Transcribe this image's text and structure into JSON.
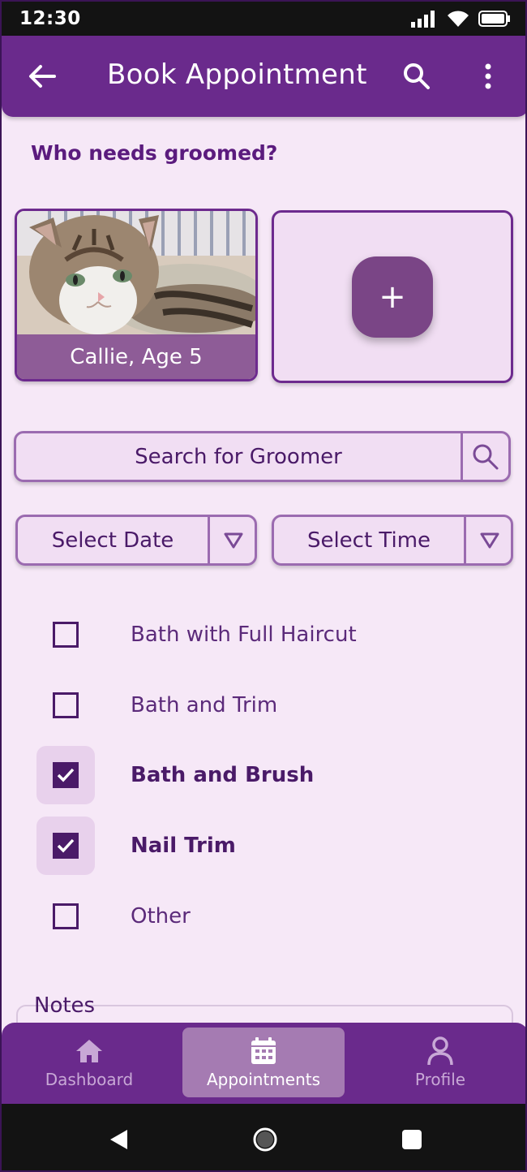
{
  "status_bar": {
    "time": "12:30"
  },
  "app_bar": {
    "title": "Book Appointment"
  },
  "section": {
    "title": "Who needs groomed?"
  },
  "pets": [
    {
      "caption": "Callie, Age 5"
    }
  ],
  "add_pet": {
    "symbol": "+"
  },
  "search_groomer": {
    "label": "Search for Groomer"
  },
  "date_select": {
    "label": "Select Date"
  },
  "time_select": {
    "label": "Select Time"
  },
  "services": [
    {
      "label": "Bath with Full Haircut",
      "checked": false
    },
    {
      "label": "Bath and Trim",
      "checked": false
    },
    {
      "label": "Bath and Brush",
      "checked": true
    },
    {
      "label": "Nail Trim",
      "checked": true
    },
    {
      "label": "Other",
      "checked": false
    }
  ],
  "notes": {
    "label": "Notes"
  },
  "bottom_nav": {
    "items": [
      {
        "label": "Dashboard",
        "icon": "home-icon",
        "active": false
      },
      {
        "label": "Appointments",
        "icon": "calendar-icon",
        "active": true
      },
      {
        "label": "Profile",
        "icon": "person-icon",
        "active": false
      }
    ]
  },
  "colors": {
    "primary": "#6a2a8c",
    "background": "#f6e8f7",
    "accent_text": "#4a1a68"
  }
}
